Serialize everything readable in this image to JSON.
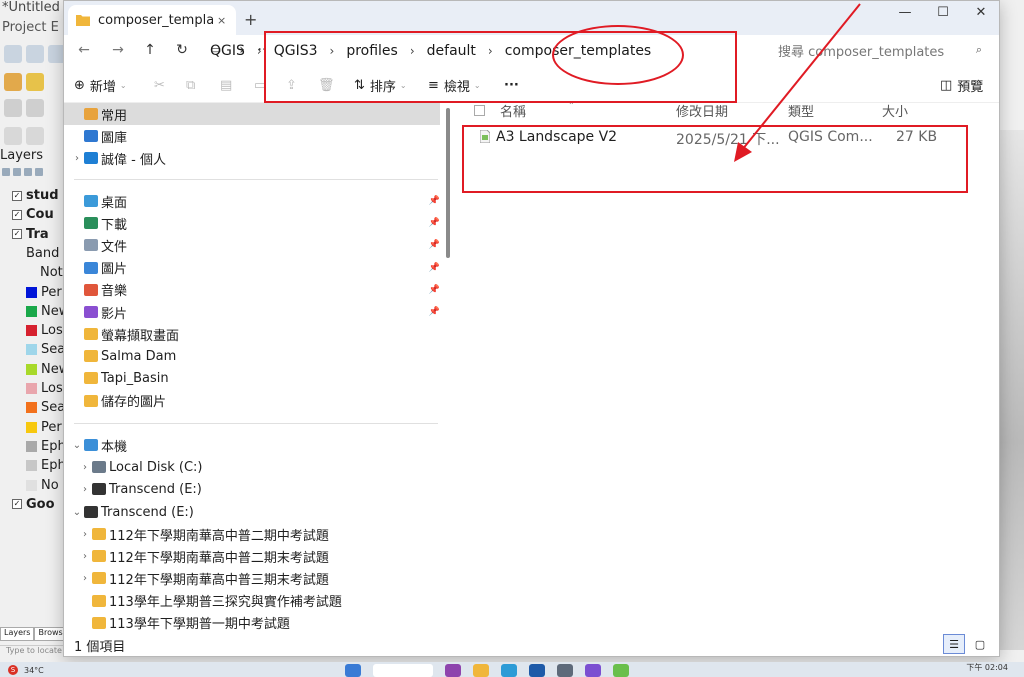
{
  "qgis": {
    "title": "*Untitled",
    "menu": "Project E",
    "layers_title": "Layers",
    "layers": [
      {
        "label": "stud",
        "bold": true,
        "checked": true,
        "swatch": ""
      },
      {
        "label": "Cou",
        "bold": true,
        "checked": true,
        "swatch": ""
      },
      {
        "label": "Tra",
        "bold": true,
        "checked": true,
        "swatch": ""
      },
      {
        "label": "Band",
        "sub": true
      },
      {
        "label": "Not",
        "sub2": true
      },
      {
        "label": "Per",
        "swatch": "#0015d8"
      },
      {
        "label": "New",
        "swatch": "#1aa84a"
      },
      {
        "label": "Los",
        "swatch": "#d6212f"
      },
      {
        "label": "Sea",
        "swatch": "#9fd6ea"
      },
      {
        "label": "New",
        "swatch": "#a8d92a"
      },
      {
        "label": "Los",
        "swatch": "#e9a6ad"
      },
      {
        "label": "Sea",
        "swatch": "#f2711c"
      },
      {
        "label": "Per",
        "swatch": "#f7c80f"
      },
      {
        "label": "Eph",
        "swatch": "#a9a9a9"
      },
      {
        "label": "Eph",
        "swatch": "#c7c7c7"
      },
      {
        "label": "No",
        "swatch": "#e0e0e0"
      },
      {
        "label": "Goo",
        "bold": true,
        "checked": true,
        "swatch": ""
      }
    ],
    "tabs": [
      "Layers",
      "Brows"
    ],
    "locate_placeholder": "Type to locate"
  },
  "explorer": {
    "tab_title": "composer_templat",
    "tab_close": "×",
    "new_tab": "+",
    "window_controls": {
      "minimize": "—",
      "maximize": "☐",
      "close": "✕"
    },
    "nav": {
      "back": "←",
      "forward": "→",
      "up": "↑",
      "refresh": "↻"
    },
    "breadcrumb": [
      "QGIS",
      "QGIS3",
      "profiles",
      "default",
      "composer_templates"
    ],
    "search_placeholder": "搜尋 composer_templates",
    "commands": {
      "new": "新增",
      "sort": "排序",
      "view": "檢視",
      "more": "···",
      "preview": "預覽"
    },
    "nav_pane": {
      "quick": [
        {
          "label": "常用",
          "selected": true,
          "color": "#e8a33d"
        },
        {
          "label": "圖庫",
          "color": "#2f78d1"
        },
        {
          "label": "誠偉 - 個人",
          "color": "#1e7fd4",
          "chevron": true
        }
      ],
      "pinned": [
        {
          "label": "桌面",
          "color": "#3b9ad9"
        },
        {
          "label": "下載",
          "color": "#2a8f5b"
        },
        {
          "label": "文件",
          "color": "#8a9bb0"
        },
        {
          "label": "圖片",
          "color": "#3a86d8"
        },
        {
          "label": "音樂",
          "color": "#e0563b"
        },
        {
          "label": "影片",
          "color": "#8a4fd1"
        }
      ],
      "folders": [
        "螢幕擷取畫面",
        "Salma Dam",
        "Tapi_Basin",
        "儲存的圖片"
      ],
      "this_pc": "本機",
      "drives": [
        "Local Disk (C:)",
        "Transcend (E:)"
      ],
      "transcend": "Transcend (E:)",
      "sub_folders": [
        {
          "label": "112年下學期南華高中普二期中考試題",
          "chevron": true
        },
        {
          "label": "112年下學期南華高中普二期末考試題",
          "chevron": true
        },
        {
          "label": "112年下學期南華高中普三期末考試題",
          "chevron": true
        },
        {
          "label": "113學年上學期普三探究與實作補考試題",
          "chevron": false
        },
        {
          "label": "113學年下學期普一期中考試題",
          "chevron": false
        }
      ]
    },
    "columns": {
      "name": "名稱",
      "date": "修改日期",
      "type": "類型",
      "size": "大小"
    },
    "files": [
      {
        "name": "A3 Landscape V2",
        "date": "2025/5/21 下...",
        "type": "QGIS Com...",
        "size": "27 KB"
      }
    ],
    "status": "1 個項目"
  },
  "taskbar": {
    "temperature": "34°C",
    "clock": "下午 02:04"
  },
  "colors": {
    "annotation": "#e01b24",
    "tab_bar": "#e9eef6"
  }
}
